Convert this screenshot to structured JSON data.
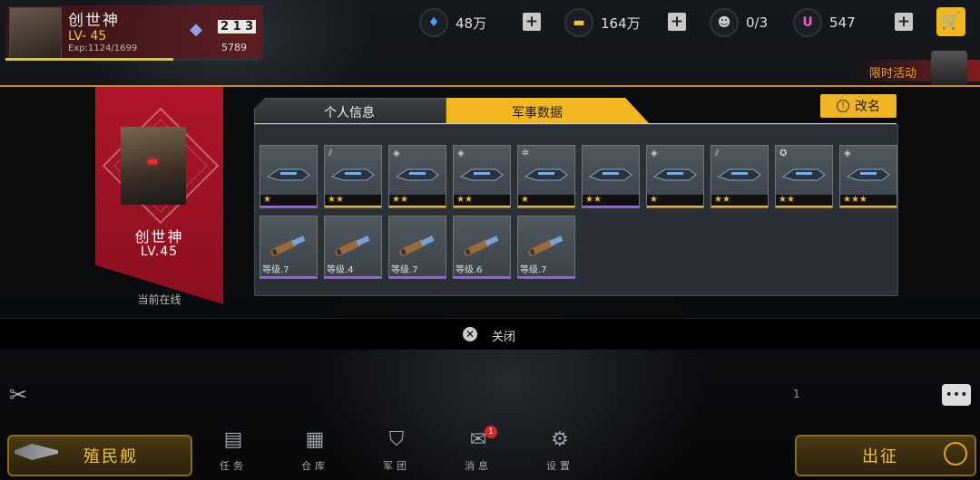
{
  "player": {
    "name": "创世神",
    "level": "LV- 45",
    "exp": "Exp:1124/1699",
    "exp_progress": 0.66,
    "rank_value": "5789",
    "rank_podium": "2 1 3"
  },
  "resources": [
    {
      "icon": "crystal-icon",
      "value": "48万"
    },
    {
      "icon": "gold-icon",
      "value": "164万"
    },
    {
      "icon": "crew-icon",
      "value": "0/3"
    },
    {
      "icon": "u-currency-icon",
      "value": "547"
    }
  ],
  "limited_event": {
    "label": "限时活动"
  },
  "profile": {
    "name": "创世神",
    "level": "LV.45",
    "status": "当前在线"
  },
  "tabs": {
    "personal": "个人信息",
    "military": "军事数据",
    "active": "military"
  },
  "rename_label": "改名",
  "ships": [
    {
      "stars": "★",
      "rarity_color": "#a35cf0",
      "badge": ""
    },
    {
      "stars": "★★",
      "rarity_color": "#f3b81f",
      "badge": "⫽"
    },
    {
      "stars": "★★",
      "rarity_color": "#f3b81f",
      "badge": "◈"
    },
    {
      "stars": "★★",
      "rarity_color": "#f3b81f",
      "badge": "◈"
    },
    {
      "stars": "★",
      "rarity_color": "#f3b81f",
      "badge": "✲"
    },
    {
      "stars": "★★",
      "rarity_color": "#a35cf0",
      "badge": ""
    },
    {
      "stars": "★",
      "rarity_color": "#f3b81f",
      "badge": "◈"
    },
    {
      "stars": "★★",
      "rarity_color": "#f3b81f",
      "badge": "⫽"
    },
    {
      "stars": "★★",
      "rarity_color": "#f3b81f",
      "badge": "✪"
    },
    {
      "stars": "★★★",
      "rarity_color": "#f3b81f",
      "badge": "◈"
    }
  ],
  "weapons": [
    {
      "level": "等级.7",
      "rarity_color": "#a35cf0"
    },
    {
      "level": "等级.4",
      "rarity_color": "#a35cf0"
    },
    {
      "level": "等级.7",
      "rarity_color": "#a35cf0"
    },
    {
      "level": "等级.6",
      "rarity_color": "#a35cf0"
    },
    {
      "level": "等级.7",
      "rarity_color": "#a35cf0"
    }
  ],
  "close_label": "关闭",
  "colony_label": "殖民舰",
  "sortie_label": "出征",
  "marker": "1",
  "nav": [
    {
      "label": "任务",
      "icon": "tasks-icon"
    },
    {
      "label": "仓库",
      "icon": "warehouse-icon"
    },
    {
      "label": "军团",
      "icon": "legion-icon"
    },
    {
      "label": "消息",
      "icon": "mail-icon"
    },
    {
      "label": "设置",
      "icon": "settings-icon"
    }
  ],
  "nav_msg_badge": "1",
  "accent_color": "#f3b81f"
}
